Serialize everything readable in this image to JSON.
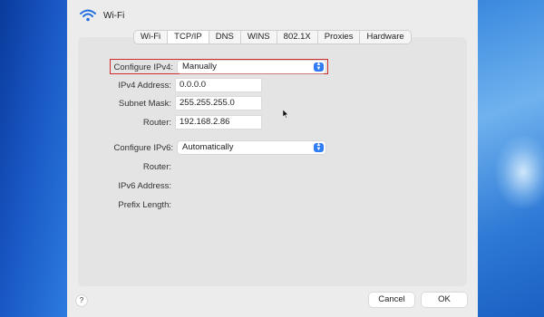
{
  "window": {
    "title": "Wi-Fi",
    "icon": "wifi-icon"
  },
  "tabs": [
    {
      "label": "Wi-Fi"
    },
    {
      "label": "TCP/IP",
      "active": true
    },
    {
      "label": "DNS"
    },
    {
      "label": "WINS"
    },
    {
      "label": "802.1X"
    },
    {
      "label": "Proxies"
    },
    {
      "label": "Hardware"
    }
  ],
  "ipv4": {
    "configure_label": "Configure IPv4:",
    "configure_value": "Manually",
    "address_label": "IPv4 Address:",
    "address_value": "0.0.0.0",
    "subnet_label": "Subnet Mask:",
    "subnet_value": "255.255.255.0",
    "router_label": "Router:",
    "router_value": "192.168.2.86"
  },
  "ipv6": {
    "configure_label": "Configure IPv6:",
    "configure_value": "Automatically",
    "router_label": "Router:",
    "address_label": "IPv6 Address:",
    "prefix_label": "Prefix Length:"
  },
  "footer": {
    "help_label": "?",
    "cancel_label": "Cancel",
    "ok_label": "OK"
  },
  "colors": {
    "highlight": "#d22b2b",
    "accent": "#2f7cf6"
  }
}
